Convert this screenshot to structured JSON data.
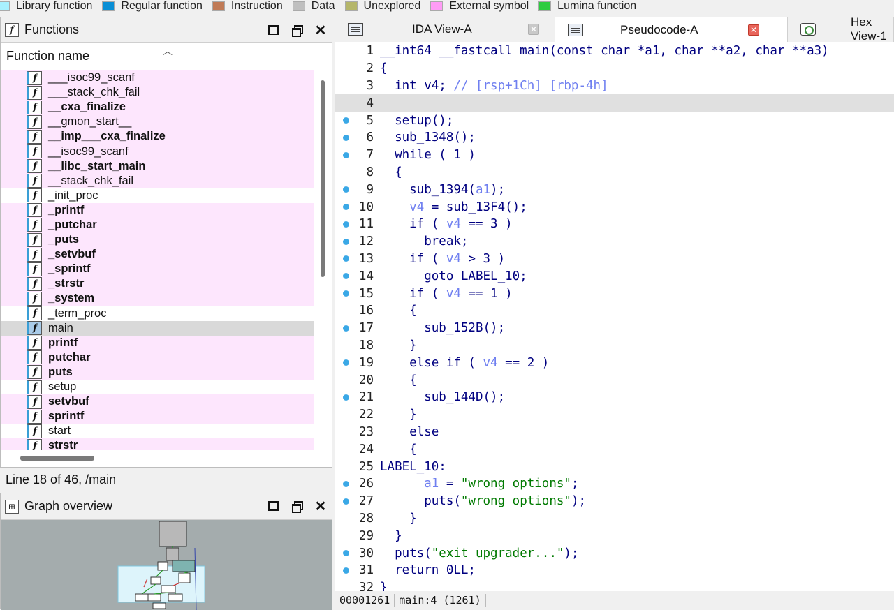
{
  "legend": [
    {
      "label": "Library function",
      "color": "#a8f0ff"
    },
    {
      "label": "Regular function",
      "color": "#0a8fd6"
    },
    {
      "label": "Instruction",
      "color": "#c07a56"
    },
    {
      "label": "Data",
      "color": "#bfbfbf"
    },
    {
      "label": "Unexplored",
      "color": "#b5b66a"
    },
    {
      "label": "External symbol",
      "color": "#ff9cf6"
    },
    {
      "label": "Lumina function",
      "color": "#2ecc40"
    }
  ],
  "functions_panel": {
    "title": "Functions",
    "column_header": "Function name",
    "items": [
      {
        "name": "___isoc99_scanf",
        "style": "pink"
      },
      {
        "name": "___stack_chk_fail",
        "style": "pink"
      },
      {
        "name": "__cxa_finalize",
        "style": "pink bold"
      },
      {
        "name": "__gmon_start__",
        "style": "pink"
      },
      {
        "name": "__imp___cxa_finalize",
        "style": "pink bold"
      },
      {
        "name": "__isoc99_scanf",
        "style": "pink"
      },
      {
        "name": "__libc_start_main",
        "style": "pink bold"
      },
      {
        "name": "__stack_chk_fail",
        "style": "pink"
      },
      {
        "name": "_init_proc",
        "style": ""
      },
      {
        "name": "_printf",
        "style": "pink bold"
      },
      {
        "name": "_putchar",
        "style": "pink bold"
      },
      {
        "name": "_puts",
        "style": "pink bold"
      },
      {
        "name": "_setvbuf",
        "style": "pink bold"
      },
      {
        "name": "_sprintf",
        "style": "pink bold"
      },
      {
        "name": "_strstr",
        "style": "pink bold"
      },
      {
        "name": "_system",
        "style": "pink bold"
      },
      {
        "name": "_term_proc",
        "style": ""
      },
      {
        "name": "main",
        "style": "selected"
      },
      {
        "name": "printf",
        "style": "pink bold"
      },
      {
        "name": "putchar",
        "style": "pink bold"
      },
      {
        "name": "puts",
        "style": "pink bold"
      },
      {
        "name": "setup",
        "style": ""
      },
      {
        "name": "setvbuf",
        "style": "pink bold"
      },
      {
        "name": "sprintf",
        "style": "pink bold"
      },
      {
        "name": "start",
        "style": ""
      },
      {
        "name": "strstr",
        "style": "pink bold"
      }
    ],
    "status": "Line 18 of 46, /main"
  },
  "graph_panel": {
    "title": "Graph overview"
  },
  "tabs": [
    {
      "label": "IDA View-A",
      "close": "grey"
    },
    {
      "label": "Pseudocode-A",
      "close": "red",
      "active": true
    },
    {
      "label": "Hex View-1",
      "close": ""
    }
  ],
  "code": {
    "lines": [
      {
        "n": "1",
        "bp": false,
        "html": "__int64 __fastcall main(const char *a1, char **a2, char **a3)"
      },
      {
        "n": "2",
        "bp": false,
        "html": "{"
      },
      {
        "n": "3",
        "bp": false,
        "html": "  int v4; <span class=\"cm\">// [rsp+1Ch] [rbp-4h]</span>"
      },
      {
        "n": "4",
        "bp": false,
        "html": "",
        "hl": true
      },
      {
        "n": "5",
        "bp": true,
        "html": "  setup();"
      },
      {
        "n": "6",
        "bp": true,
        "html": "  sub_1348();"
      },
      {
        "n": "7",
        "bp": true,
        "html": "  while ( 1 )"
      },
      {
        "n": "8",
        "bp": false,
        "html": "  {"
      },
      {
        "n": "9",
        "bp": true,
        "html": "    sub_1394(<span class=\"var\">a1</span>);"
      },
      {
        "n": "10",
        "bp": true,
        "html": "    <span class=\"var\">v4</span> = sub_13F4();"
      },
      {
        "n": "11",
        "bp": true,
        "html": "    if ( <span class=\"var\">v4</span> == 3 )"
      },
      {
        "n": "12",
        "bp": true,
        "html": "      break;"
      },
      {
        "n": "13",
        "bp": true,
        "html": "    if ( <span class=\"var\">v4</span> > 3 )"
      },
      {
        "n": "14",
        "bp": true,
        "html": "      goto LABEL_10;"
      },
      {
        "n": "15",
        "bp": true,
        "html": "    if ( <span class=\"var\">v4</span> == 1 )"
      },
      {
        "n": "16",
        "bp": false,
        "html": "    {"
      },
      {
        "n": "17",
        "bp": true,
        "html": "      sub_152B();"
      },
      {
        "n": "18",
        "bp": false,
        "html": "    }"
      },
      {
        "n": "19",
        "bp": true,
        "html": "    else if ( <span class=\"var\">v4</span> == 2 )"
      },
      {
        "n": "20",
        "bp": false,
        "html": "    {"
      },
      {
        "n": "21",
        "bp": true,
        "html": "      sub_144D();"
      },
      {
        "n": "22",
        "bp": false,
        "html": "    }"
      },
      {
        "n": "23",
        "bp": false,
        "html": "    else"
      },
      {
        "n": "24",
        "bp": false,
        "html": "    {"
      },
      {
        "n": "25",
        "bp": false,
        "html": "LABEL_10:"
      },
      {
        "n": "26",
        "bp": true,
        "html": "      <span class=\"var\">a1</span> = <span class=\"str\">\"wrong options\"</span>;"
      },
      {
        "n": "27",
        "bp": true,
        "html": "      puts(<span class=\"str\">\"wrong options\"</span>);"
      },
      {
        "n": "28",
        "bp": false,
        "html": "    }"
      },
      {
        "n": "29",
        "bp": false,
        "html": "  }"
      },
      {
        "n": "30",
        "bp": true,
        "html": "  puts(<span class=\"str\">\"exit upgrader...\"</span>);"
      },
      {
        "n": "31",
        "bp": true,
        "html": "  return 0LL;"
      },
      {
        "n": "32",
        "bp": false,
        "html": "}"
      }
    ],
    "status_address": "00001261",
    "status_location": "main:4 (1261)"
  }
}
